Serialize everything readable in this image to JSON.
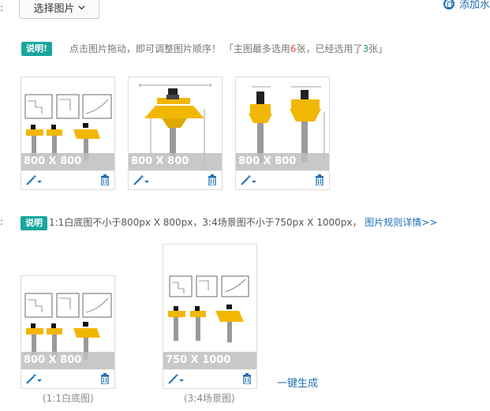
{
  "top": {
    "colon": ":",
    "select_button_label": "选择图片",
    "add_link_label": "添加水"
  },
  "note1": {
    "badge": "说明!",
    "text_prefix": "点击图片拖动，即可调整图片顺序！ 「主图最多选用",
    "max_count": "6",
    "text_mid": "张，已经选用了",
    "used_count": "3",
    "text_suffix": "张」"
  },
  "main_images": [
    {
      "size": "800 X 800"
    },
    {
      "size": "800 X 800"
    },
    {
      "size": "800 X 800"
    }
  ],
  "note2": {
    "colon": ":",
    "badge": "说明",
    "text": "1:1白底图不小于800px X 800px，3:4场景图不小于750px X 1000px，",
    "rules_link": "图片规则详情>>"
  },
  "scene_images": [
    {
      "size": "800 X 800",
      "caption": "(1:1白底图)"
    },
    {
      "size": "750 X 1000",
      "caption": "(3:4场景图)"
    }
  ],
  "generate_link": "一键生成",
  "colors": {
    "accent_teal": "#1aa6a0",
    "link_blue": "#1f6fb5",
    "bit_yellow": "#f2b705",
    "red": "#e64545",
    "green": "#2e9e5b"
  }
}
